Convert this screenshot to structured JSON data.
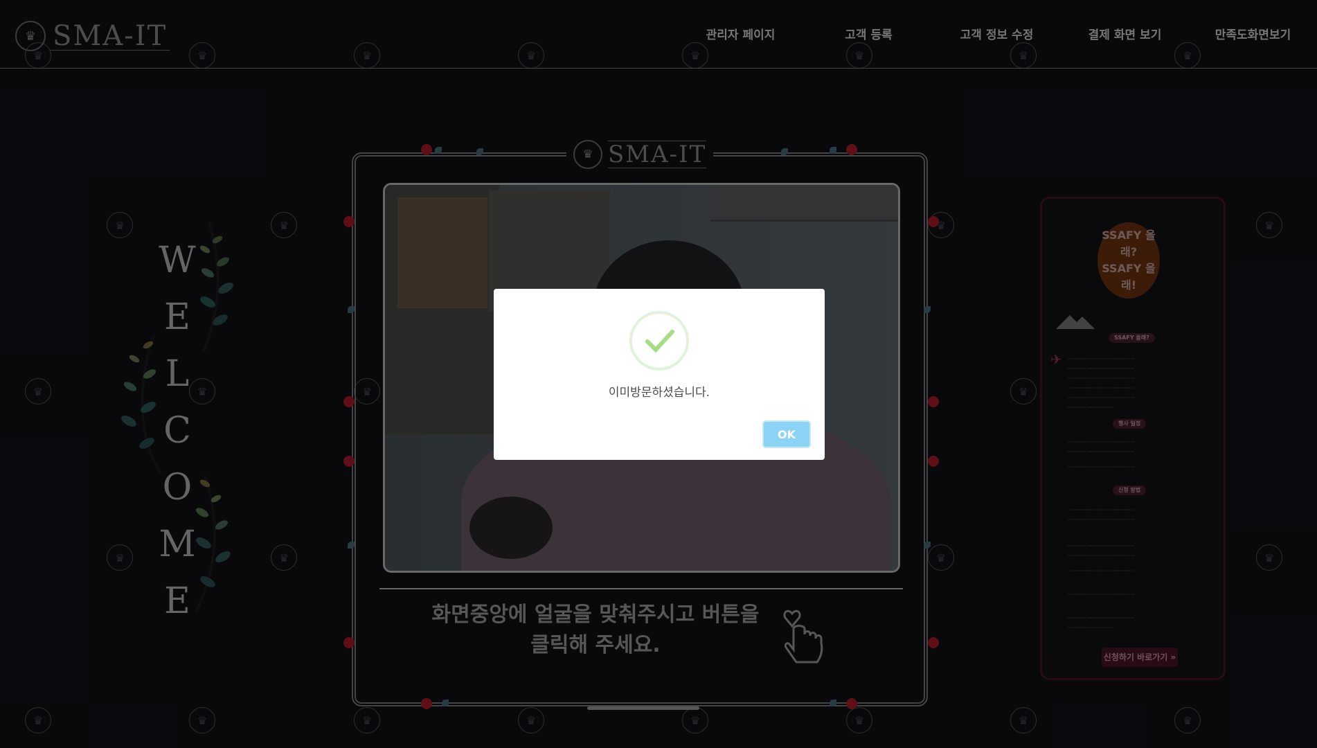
{
  "header": {
    "logo_text": "SMA-IT",
    "nav": [
      {
        "label": "관리자 페이지"
      },
      {
        "label": "고객 등록"
      },
      {
        "label": "고객 정보 수정"
      },
      {
        "label": "결제 화면 보기"
      },
      {
        "label": "만족도화면보기"
      }
    ]
  },
  "welcome": {
    "letters": [
      "W",
      "E",
      "L",
      "C",
      "O",
      "M",
      "E"
    ]
  },
  "frame": {
    "logo_text": "SMA-IT",
    "instruction_line1": "화면중앙에 얼굴을 맞춰주시고 버튼을",
    "instruction_line2": "클릭해 주세요."
  },
  "poster": {
    "balloon_line1": "SSAFY 올래?",
    "balloon_line2": "SSAFY 올래!",
    "tag_top": "SSAFY 올래?",
    "tag_schedule": "행사 일정",
    "tag_apply": "신청 방법",
    "cta": "신청하기 바로가기 »"
  },
  "dialog": {
    "message": "이미방문하셨습니다.",
    "ok_label": "OK",
    "accent_color": "#8cd4f5",
    "check_color": "#a5dc86"
  }
}
